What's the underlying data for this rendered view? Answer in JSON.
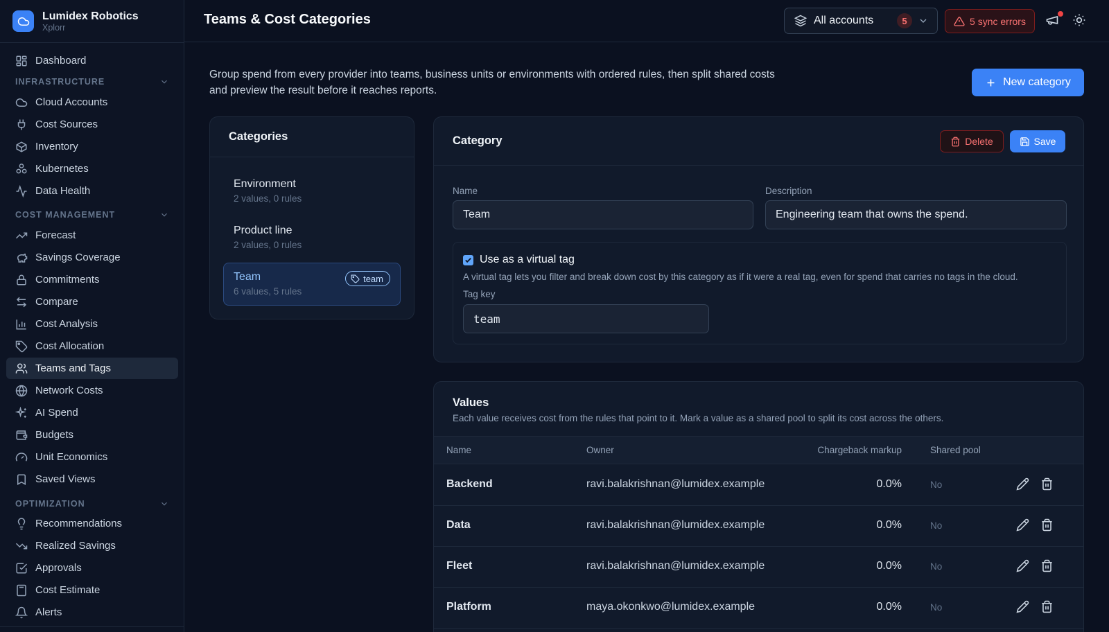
{
  "brand": {
    "name": "Lumidex Robotics",
    "sub": "Xplorr"
  },
  "nav": {
    "dashboard": "Dashboard",
    "sections": {
      "infrastructure": "INFRASTRUCTURE",
      "cost_management": "COST MANAGEMENT",
      "optimization": "OPTIMIZATION"
    },
    "items": {
      "cloud_accounts": "Cloud Accounts",
      "cost_sources": "Cost Sources",
      "inventory": "Inventory",
      "kubernetes": "Kubernetes",
      "data_health": "Data Health",
      "forecast": "Forecast",
      "savings_coverage": "Savings Coverage",
      "commitments": "Commitments",
      "compare": "Compare",
      "cost_analysis": "Cost Analysis",
      "cost_allocation": "Cost Allocation",
      "teams_and_tags": "Teams and Tags",
      "network_costs": "Network Costs",
      "ai_spend": "AI Spend",
      "budgets": "Budgets",
      "unit_economics": "Unit Economics",
      "saved_views": "Saved Views",
      "recommendations": "Recommendations",
      "realized_savings": "Realized Savings",
      "approvals": "Approvals",
      "cost_estimate": "Cost Estimate",
      "alerts": "Alerts"
    },
    "active": "teams_and_tags"
  },
  "header": {
    "title": "Teams & Cost Categories",
    "accounts_label": "All accounts",
    "accounts_count": "5",
    "sync_errors": "5 sync errors"
  },
  "intro": "Group spend from every provider into teams, business units or environments with ordered rules, then split shared costs and preview the result before it reaches reports.",
  "new_category_label": "New category",
  "categories": {
    "title": "Categories",
    "items": [
      {
        "name": "Environment",
        "meta": "2 values, 0 rules"
      },
      {
        "name": "Product line",
        "meta": "2 values, 0 rules"
      },
      {
        "name": "Team",
        "meta": "6 values, 5 rules",
        "tag": "team"
      }
    ]
  },
  "category": {
    "title": "Category",
    "delete_label": "Delete",
    "save_label": "Save",
    "name_label": "Name",
    "name_value": "Team",
    "description_label": "Description",
    "description_value": "Engineering team that owns the spend.",
    "virtual_tag_label": "Use as a virtual tag",
    "virtual_tag_checked": true,
    "virtual_tag_help": "A virtual tag lets you filter and break down cost by this category as if it were a real tag, even for spend that carries no tags in the cloud.",
    "tag_key_label": "Tag key",
    "tag_key_value": "team"
  },
  "values": {
    "title": "Values",
    "description": "Each value receives cost from the rules that point to it. Mark a value as a shared pool to split its cost across the others.",
    "columns": {
      "name": "Name",
      "owner": "Owner",
      "markup": "Chargeback markup",
      "shared": "Shared pool"
    },
    "rows": [
      {
        "name": "Backend",
        "owner": "ravi.balakrishnan@lumidex.example",
        "markup": "0.0%",
        "shared": "No"
      },
      {
        "name": "Data",
        "owner": "ravi.balakrishnan@lumidex.example",
        "markup": "0.0%",
        "shared": "No"
      },
      {
        "name": "Fleet",
        "owner": "ravi.balakrishnan@lumidex.example",
        "markup": "0.0%",
        "shared": "No"
      },
      {
        "name": "Platform",
        "owner": "maya.okonkwo@lumidex.example",
        "markup": "0.0%",
        "shared": "No"
      }
    ]
  },
  "colors": {
    "accent": "#3b82f6",
    "danger": "#f87171",
    "background": "#0b1120",
    "panel": "#111a2b"
  }
}
